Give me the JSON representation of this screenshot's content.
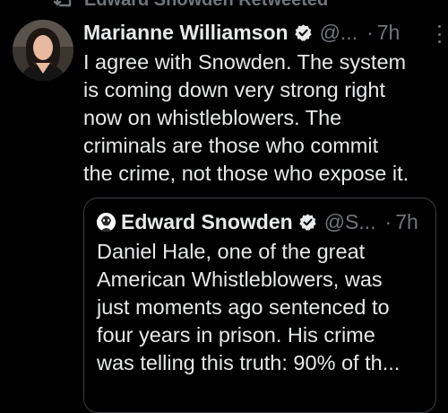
{
  "retweet_context": {
    "label": "Edward Snowden Retweeted",
    "icon": "retweet-icon"
  },
  "tweet": {
    "avatar_icon": "profile-photo",
    "author_name": "Marianne Williamson",
    "verified_icon": "verified-badge-icon",
    "handle": "@...",
    "separator": "·",
    "time": "7h",
    "more_icon": "more-options-icon",
    "text_lines": [
      "I agree with Snowden. The system",
      "is coming down very strong right",
      "now on whistleblowers. The",
      "criminals are those who commit",
      "the crime, not those who expose it."
    ]
  },
  "quoted_tweet": {
    "avatar_icon": "profile-photo",
    "author_name": "Edward Snowden",
    "verified_icon": "verified-badge-icon",
    "handle": "@S...",
    "separator": "·",
    "time": "7h",
    "text_lines": [
      "Daniel Hale, one of the great",
      "American Whistleblowers, was",
      "just moments ago sentenced to",
      "four years in prison. His crime",
      "was telling this truth: 90% of th..."
    ]
  },
  "colors": {
    "background": "#000000",
    "text_primary": "#e7e9ea",
    "text_secondary": "#71767b",
    "verified_blue": "#1d9bf0",
    "card_border": "#3a3f44"
  }
}
